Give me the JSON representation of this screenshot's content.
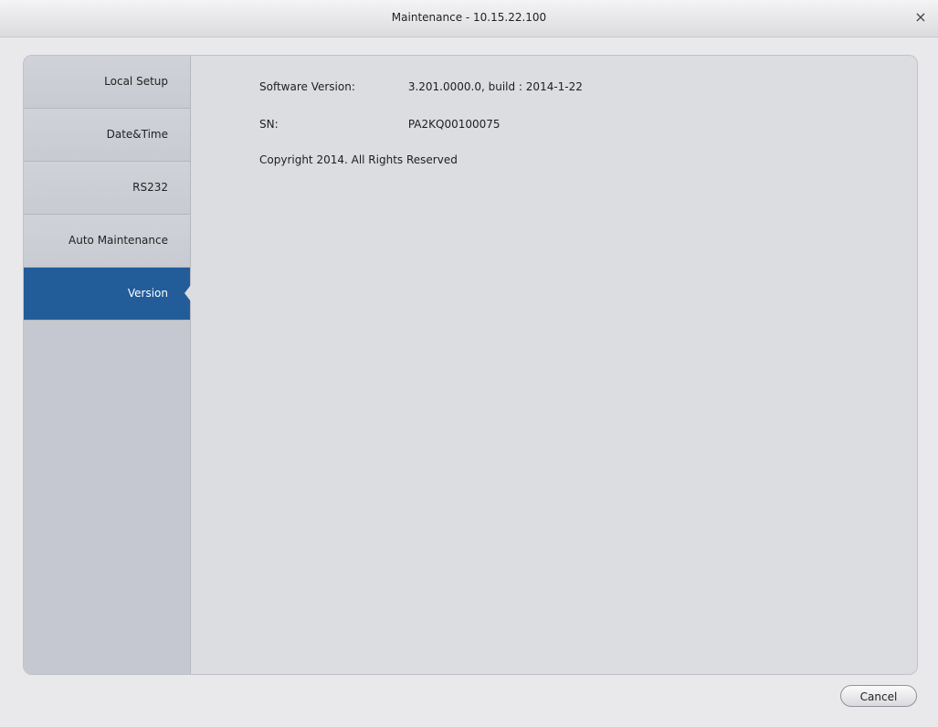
{
  "window": {
    "title": "Maintenance - 10.15.22.100",
    "close_glyph": "×"
  },
  "sidebar": {
    "items": [
      {
        "label": "Local Setup"
      },
      {
        "label": "Date&Time"
      },
      {
        "label": "RS232"
      },
      {
        "label": "Auto Maintenance"
      },
      {
        "label": "Version",
        "active": true
      }
    ]
  },
  "version_info": {
    "software_version_label": "Software Version:",
    "software_version_value": "3.201.0000.0, build : 2014-1-22",
    "sn_label": "SN:",
    "sn_value": "PA2KQ00100075",
    "copyright": "Copyright 2014. All Rights Reserved"
  },
  "footer": {
    "cancel_label": "Cancel"
  },
  "colors": {
    "active_nav": "#225d9a",
    "sidebar_bg": "#c5c8d0",
    "content_bg": "#dcdde1"
  }
}
